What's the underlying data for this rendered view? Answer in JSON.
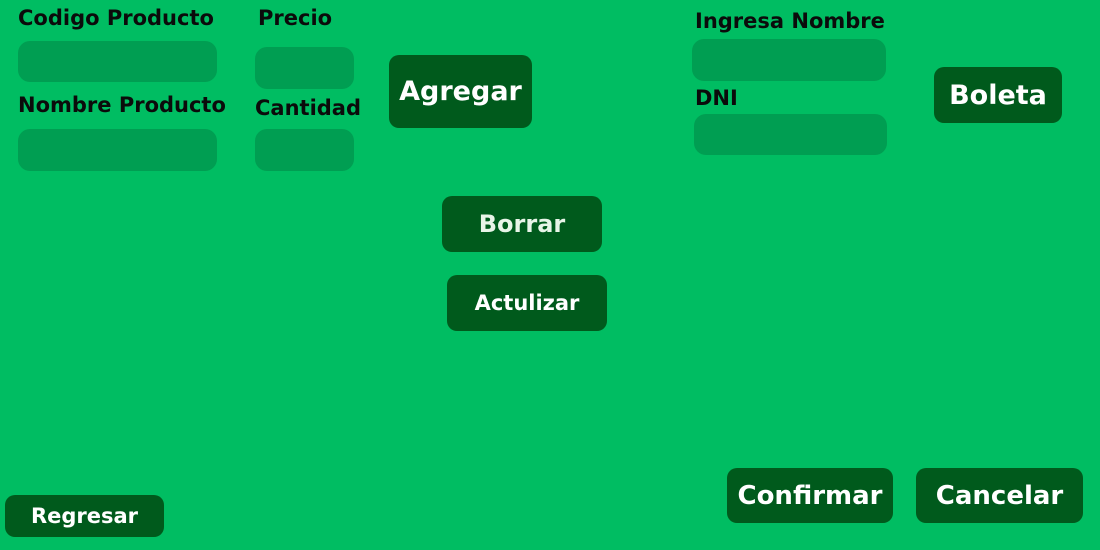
{
  "colors": {
    "background": "#00BD62",
    "field": "#009E52",
    "button": "#005A1C",
    "button_text": "#FFFFFF",
    "label_text": "#0B0B0B",
    "borrar_text": "#E8F5E8"
  },
  "product_form": {
    "codigo_label": "Codigo Producto",
    "codigo_value": "",
    "nombre_label": "Nombre Producto",
    "nombre_value": "",
    "precio_label": "Precio",
    "precio_value": "",
    "cantidad_label": "Cantidad",
    "cantidad_value": ""
  },
  "customer_form": {
    "nombre_label": "Ingresa Nombre",
    "nombre_value": "",
    "dni_label": "DNI",
    "dni_value": ""
  },
  "buttons": {
    "agregar": "Agregar",
    "boleta": "Boleta",
    "borrar": "Borrar",
    "actualizar": "Actulizar",
    "confirmar": "Confirmar",
    "cancelar": "Cancelar",
    "regresar": "Regresar"
  }
}
